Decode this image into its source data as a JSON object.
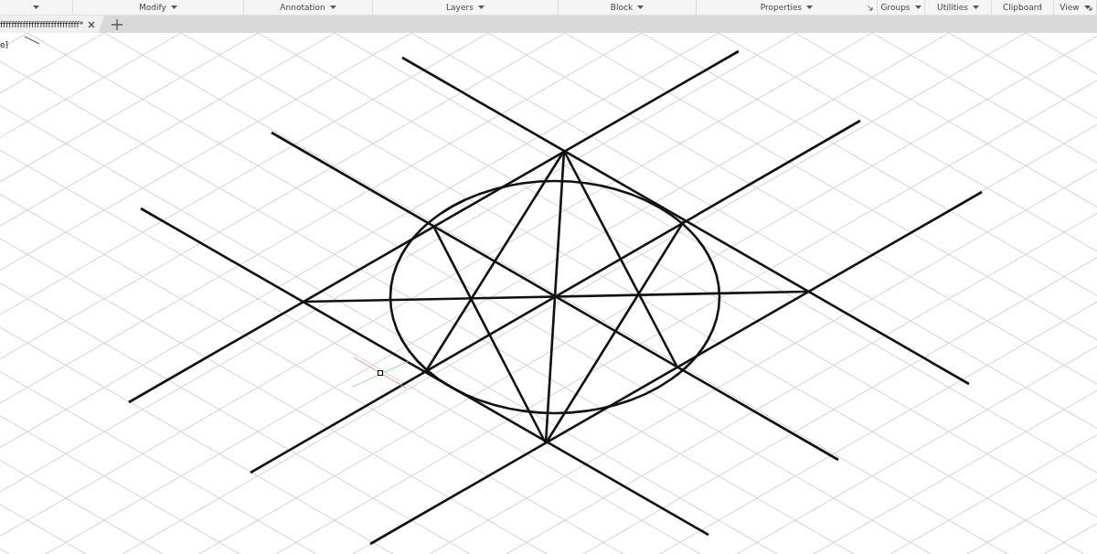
{
  "ribbon_panels": [
    {
      "dropdown": true
    },
    {
      "label": "Modify",
      "dropdown": true
    },
    {
      "label": "Annotation",
      "dropdown": true
    },
    {
      "label": "Layers",
      "dropdown": true
    },
    {
      "label": "Block",
      "dropdown": true
    },
    {
      "label": "Properties",
      "dropdown": true,
      "launcher": true
    },
    {
      "label": "Groups",
      "dropdown": true
    },
    {
      "label": "Utilities",
      "dropdown": true
    },
    {
      "label": "Clipboard",
      "dropdown": false
    },
    {
      "label": "View",
      "dropdown": true,
      "launcher": true
    }
  ],
  "file_tabs": [
    {
      "label": "ffffffffffffffffffffffffffff*",
      "selected": true
    }
  ],
  "viewport_label": "e]"
}
